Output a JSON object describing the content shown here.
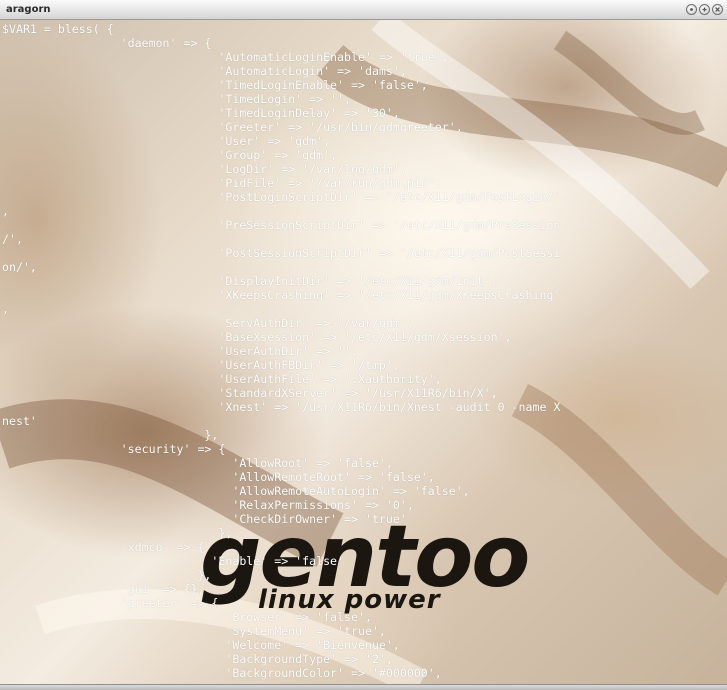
{
  "window": {
    "title": "aragorn",
    "buttons": {
      "minimize_icon": "minimize-icon",
      "maximize_icon": "maximize-icon",
      "close_icon": "close-icon"
    }
  },
  "wallpaper": {
    "logo_word": "gentoo",
    "logo_tagline": "linux power"
  },
  "terminal": {
    "lines": [
      "$VAR1 = bless( {",
      "                 'daemon' => {",
      "                               'AutomaticLoginEnable' => 'true',",
      "                               'AutomaticLogin' => 'dams',",
      "                               'TimedLoginEnable' => 'false',",
      "                               'TimedLogin' => '',",
      "                               'TimedLoginDelay' => '30',",
      "                               'Greeter' => '/usr/bin/gdmgreeter',",
      "                               'User' => 'gdm',",
      "                               'Group' => 'gdm',",
      "                               'LogDir' => '/var/log/gdm',",
      "                               'PidFile' => '/var/run/gdm.pid',",
      "                               'PostLoginScriptDir' => '/etc/X11/gdm/PostLogin/'",
      ",",
      "                               'PreSessionScriptDir' => '/etc/X11/gdm/PreSession",
      "/',",
      "                               'PostSessionScriptDir' => '/etc/X11/gdm/PostSessi",
      "on/',",
      "                               'DisplayInitDir' => '/etc/X11/gdm/Init',",
      "                               'XKeepsCrashing' => '/etc/X11/gdm/XKeepsCrashing'",
      ",",
      "                               'ServAuthDir' => '/var/gdm',",
      "                               'BaseXsession' => '/etc/X11/gdm/Xsession',",
      "                               'UserAuthDir' => '',",
      "                               'UserAuthFBDir' => '/tmp',",
      "                               'UserAuthFile' => '.Xauthority',",
      "                               'StandardXServer' => '/usr/X11R6/bin/X',",
      "                               'Xnest' => '/usr/X11R6/bin/Xnest -audit 0 -name X",
      "nest'",
      "                             },",
      "                 'security' => {",
      "                                 'AllowRoot' => 'false',",
      "                                 'AllowRemoteRoot' => 'false',",
      "                                 'AllowRemoteAutoLogin' => 'false',",
      "                                 'RelaxPermissions' => '0',",
      "                                 'CheckDirOwner' => 'true'",
      "                               },",
      "                 'xdmcp' => {",
      "                              'Enable' => 'false'",
      "                            },",
      "                 'gui' => {},",
      "                 'greeter' => {",
      "                                'Browser' => 'false',",
      "                                'SystemMenu' => 'true',",
      "                                'Welcome' => 'Bienvenue',",
      "                                'BackgroundType' => '2',",
      "                                'BackgroundColor' => '#000000',"
    ]
  },
  "colors": {
    "terminal_text": "#ffffff",
    "logo": "#1b1610"
  }
}
